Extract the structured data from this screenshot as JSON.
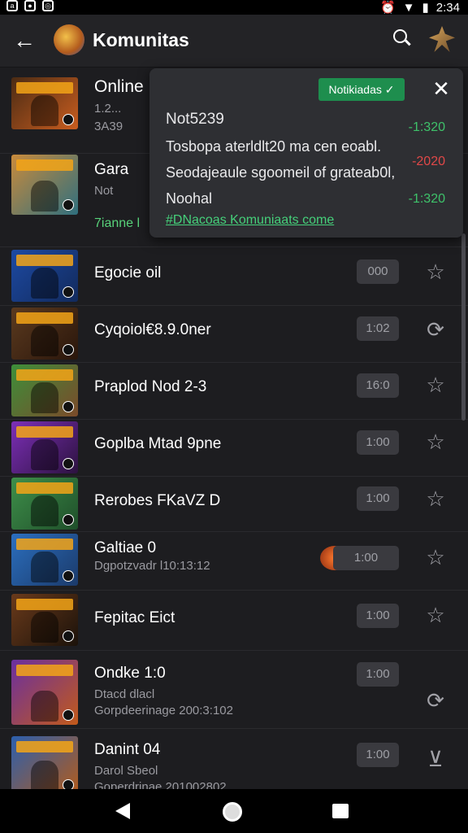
{
  "status_bar": {
    "time": "2:34"
  },
  "app_bar": {
    "title": "Komunitas"
  },
  "rows": [
    {
      "name": "Online",
      "sub1": "1.2...",
      "sub2": "3A39",
      "colors": [
        "#4a2b14",
        "#c95d1f"
      ]
    },
    {
      "name": "Gara",
      "sub1": "Not",
      "green": "7ianne l",
      "colors": [
        "#c98b3c",
        "#2f6f7e"
      ]
    },
    {
      "name": "Egocie oil",
      "pill": "000",
      "colors": [
        "#1d4aa3",
        "#122a5c"
      ]
    },
    {
      "name": "Cyqoiol€8.9.0ner",
      "pill": "1:02",
      "colors": [
        "#5b3a1f",
        "#2a160b"
      ]
    },
    {
      "name": "Praplod Nod 2-3",
      "pill": "16:0",
      "colors": [
        "#3d8f3a",
        "#7b4a2a"
      ]
    },
    {
      "name": "Goplba Mtad 9pne",
      "pill": "1:00",
      "colors": [
        "#7d2fb8",
        "#2c123f"
      ]
    },
    {
      "name": "Rerobes FKaVZ D",
      "pill": "1:00",
      "colors": [
        "#3e8f4a",
        "#1f4f2a"
      ]
    },
    {
      "name": "Galtiae 0",
      "sub1": "Dgpotzvadr l10:13:12",
      "pill": "1:00",
      "colors": [
        "#2b6fbf",
        "#1b3a6a"
      ]
    },
    {
      "name": "Fepitac Eict",
      "pill": "1:00",
      "colors": [
        "#6a3a1b",
        "#1b120a"
      ]
    },
    {
      "name": "Ondke 1:0",
      "sub1": "Dtacd dlacl",
      "sub2": "Gorpdeerinage 200:3:102",
      "pill": "1:00",
      "colors": [
        "#6a2fa0",
        "#c25a1a"
      ]
    },
    {
      "name": "Danint 04",
      "sub1": "Darol Sbeol",
      "sub2": "Goperdrinae 201002802",
      "pill": "1:00",
      "colors": [
        "#2b5fae",
        "#b35b1a"
      ]
    }
  ],
  "popup": {
    "tag": "Notikiadas ✓",
    "heading": "Not5239",
    "line1": "Tosbopa aterldlt20 ma cen eoabl.",
    "line2": "Seodajeaule sgoomeil of grateab0l,",
    "line3": "Noohal",
    "v1": "-1:320",
    "v2": "-2020",
    "v3": "-1:320",
    "link": "#DNacoas Komuniaats come",
    "colors": {
      "v1": "#3ec26a",
      "v2": "#e04848",
      "v3": "#3ec26a"
    }
  }
}
